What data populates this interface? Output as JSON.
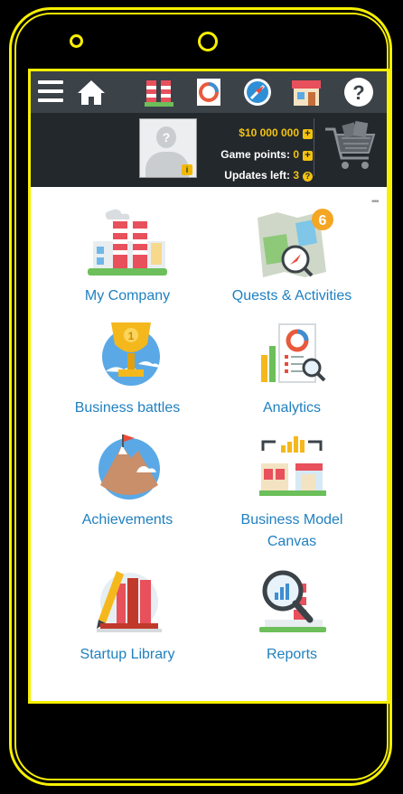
{
  "header": {
    "icons": [
      "menu-icon",
      "home-icon",
      "company-icon",
      "analytics-icon",
      "compass-icon",
      "shop-icon",
      "help-icon"
    ]
  },
  "stats": {
    "money": "$10 000 000",
    "game_points_label": "Game points:",
    "game_points_value": "0",
    "updates_label": "Updates left:",
    "updates_value": "3"
  },
  "more_label": "•••",
  "menu": {
    "my_company": "My Company",
    "quests": "Quests & Activities",
    "quests_badge": "6",
    "battles": "Business battles",
    "analytics": "Analytics",
    "achievements": "Achievements",
    "canvas": "Business Model Canvas",
    "library": "Startup Library",
    "reports": "Reports",
    "battle_medal": "1"
  },
  "colors": {
    "accent": "#f7f000",
    "topbar": "#3b4248",
    "infobar": "#23282d",
    "link": "#1f80c0",
    "gold": "#f3c20f"
  }
}
